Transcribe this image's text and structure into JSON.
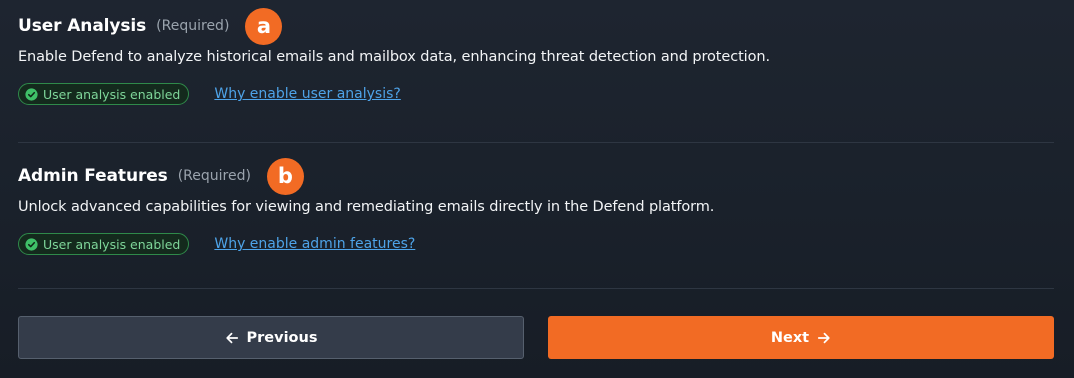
{
  "sections": [
    {
      "title": "User Analysis",
      "required_label": "(Required)",
      "marker": "a",
      "description": "Enable Defend to analyze historical emails and mailbox data, enhancing threat detection and protection.",
      "status_badge": "User analysis enabled",
      "link_text": "Why enable user analysis?"
    },
    {
      "title": "Admin Features",
      "required_label": "(Required)",
      "marker": "b",
      "description": "Unlock advanced capabilities for viewing and remediating emails directly in the Defend platform.",
      "status_badge": "User analysis enabled",
      "link_text": "Why enable admin features?"
    }
  ],
  "footer": {
    "previous_label": "Previous",
    "next_label": "Next"
  },
  "icons": {
    "status": "check-circle-icon",
    "previous": "arrow-left-icon",
    "next": "arrow-right-icon"
  },
  "colors": {
    "accent": "#f26b24",
    "link": "#4ea3e8",
    "success": "#7fd69a",
    "muted": "#9aa3ad"
  }
}
